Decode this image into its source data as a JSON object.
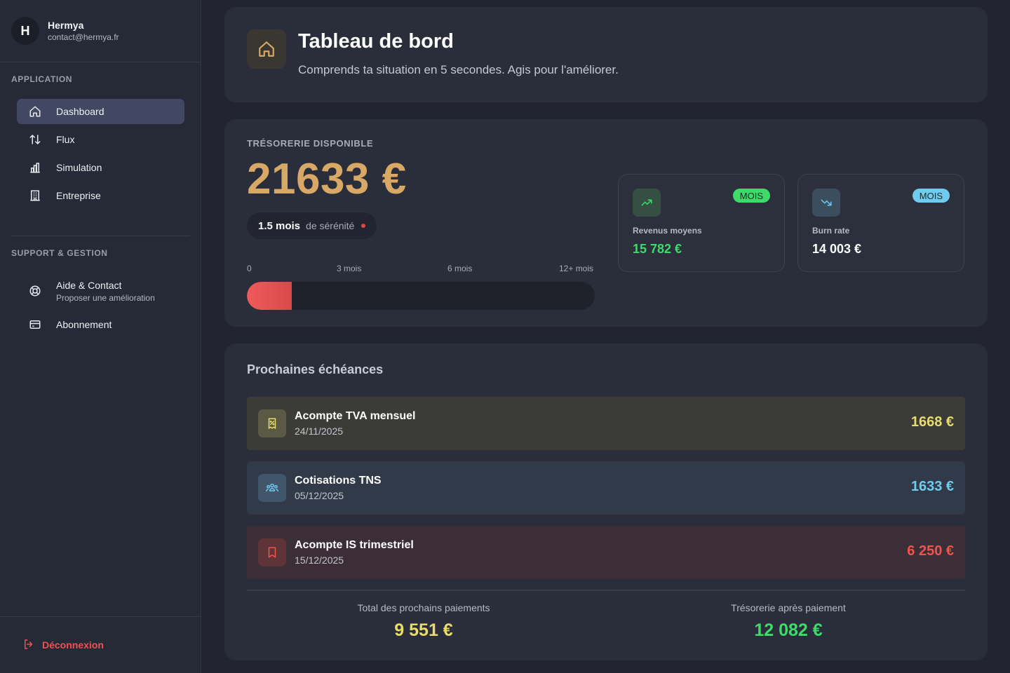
{
  "user": {
    "initial": "H",
    "name": "Hermya",
    "email": "contact@hermya.fr"
  },
  "sidebar": {
    "section_application": "APPLICATION",
    "section_support": "SUPPORT & GESTION",
    "items": [
      {
        "label": "Dashboard",
        "icon": "home-icon",
        "active": true
      },
      {
        "label": "Flux",
        "icon": "arrows-up-down-icon"
      },
      {
        "label": "Simulation",
        "icon": "bar-chart-icon"
      },
      {
        "label": "Entreprise",
        "icon": "building-icon"
      }
    ],
    "support_items": [
      {
        "label": "Aide & Contact",
        "sublabel": "Proposer une amélioration",
        "icon": "lifebuoy-icon"
      },
      {
        "label": "Abonnement",
        "icon": "credit-card-icon"
      }
    ],
    "logout_label": "Déconnexion"
  },
  "header": {
    "title": "Tableau de bord",
    "subtitle": "Comprends ta situation en 5 secondes. Agis pour l'améliorer."
  },
  "treasury": {
    "label": "TRÉSORERIE DISPONIBLE",
    "value": "21633 €",
    "serenity_value": "1.5 mois",
    "serenity_label": "de sérénité",
    "scale": [
      "0",
      "3 mois",
      "6 mois",
      "12+ mois"
    ],
    "progress_fraction": 0.13,
    "stats": [
      {
        "label": "Revenus moyens",
        "value": "15 782 €",
        "badge": "MOIS",
        "icon": "trending-up-icon",
        "color": "#3ddc6a"
      },
      {
        "label": "Burn rate",
        "value": "14 003 €",
        "badge": "MOIS",
        "icon": "trending-down-icon",
        "color": "#6fcbf0"
      }
    ]
  },
  "upcoming": {
    "title": "Prochaines échéances",
    "rows": [
      {
        "name": "Acompte TVA mensuel",
        "date": "24/11/2025",
        "amount": "1668 €",
        "icon": "receipt-percent-icon",
        "color": "#e8dc6a"
      },
      {
        "name": "Cotisations TNS",
        "date": "05/12/2025",
        "amount": "1633 €",
        "icon": "users-group-icon",
        "color": "#6fcbf0"
      },
      {
        "name": "Acompte IS trimestriel",
        "date": "15/12/2025",
        "amount": "6 250 €",
        "icon": "bookmark-icon",
        "color": "#f0524f"
      }
    ],
    "total_label": "Total des prochains paiements",
    "total_value": "9 551 €",
    "after_label": "Trésorerie après paiement",
    "after_value": "12 082 €"
  }
}
